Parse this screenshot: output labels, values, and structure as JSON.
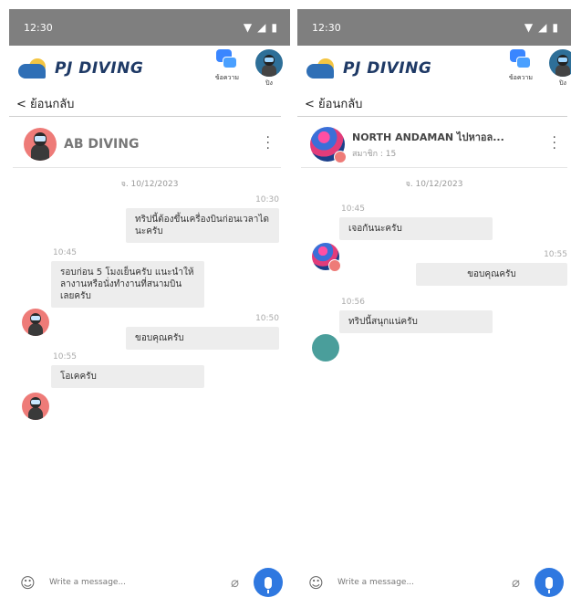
{
  "left": {
    "status": {
      "time": "12:30"
    },
    "app": {
      "logo_text": "PJ DIVING",
      "messages_label": "ข้อความ",
      "profile_label": "ปิง"
    },
    "back_label": "< ย้อนกลับ",
    "chat": {
      "title": "AB DIVING"
    },
    "date": "จ. 10/12/2023",
    "messages": [
      {
        "time": "10:30",
        "text": "ทริปนี้ต้องขึ้นเครื่องบินก่อนเวลาไดนะครับ",
        "side": "right"
      },
      {
        "time": "10:45",
        "text": "รอบก่อน 5 โมงเย็นครับ แนะนำให้ลางานหรือนั่งทำงานที่สนามบินเลยครับ",
        "side": "left"
      },
      {
        "time": "10:50",
        "text": "ขอบคุณครับ",
        "side": "right"
      },
      {
        "time": "10:55",
        "text": "โอเคครับ",
        "side": "left"
      }
    ],
    "input_placeholder": "Write a message..."
  },
  "right": {
    "status": {
      "time": "12:30"
    },
    "app": {
      "logo_text": "PJ DIVING",
      "messages_label": "ข้อความ",
      "profile_label": "ปิง"
    },
    "back_label": "< ย้อนกลับ",
    "chat": {
      "title": "NORTH ANDAMAN ไปหาอล...",
      "members": "สมาชิก : 15"
    },
    "date": "จ. 10/12/2023",
    "messages": [
      {
        "time": "10:45",
        "text": "เจอกันนะครับ",
        "side": "left"
      },
      {
        "time": "10:55",
        "text": "ขอบคุณครับ",
        "side": "right"
      },
      {
        "time": "10:56",
        "text": "ทริปนี้สนุกแน่ครับ",
        "side": "left"
      }
    ],
    "input_placeholder": "Write a message..."
  },
  "icons": {
    "wifi": "wifi-icon",
    "signal": "signal-icon",
    "battery": "battery-icon",
    "message": "message-bubbles-icon",
    "more": "more-vertical-icon",
    "emoji": "emoji-icon",
    "attach": "paperclip-icon",
    "mic": "microphone-icon"
  },
  "colors": {
    "status_bar": "#7f7f7f",
    "bubble": "#ededed",
    "mic": "#2f78e0",
    "avatar_red": "#ee7b78",
    "avatar_teal": "#4a9e9b"
  }
}
